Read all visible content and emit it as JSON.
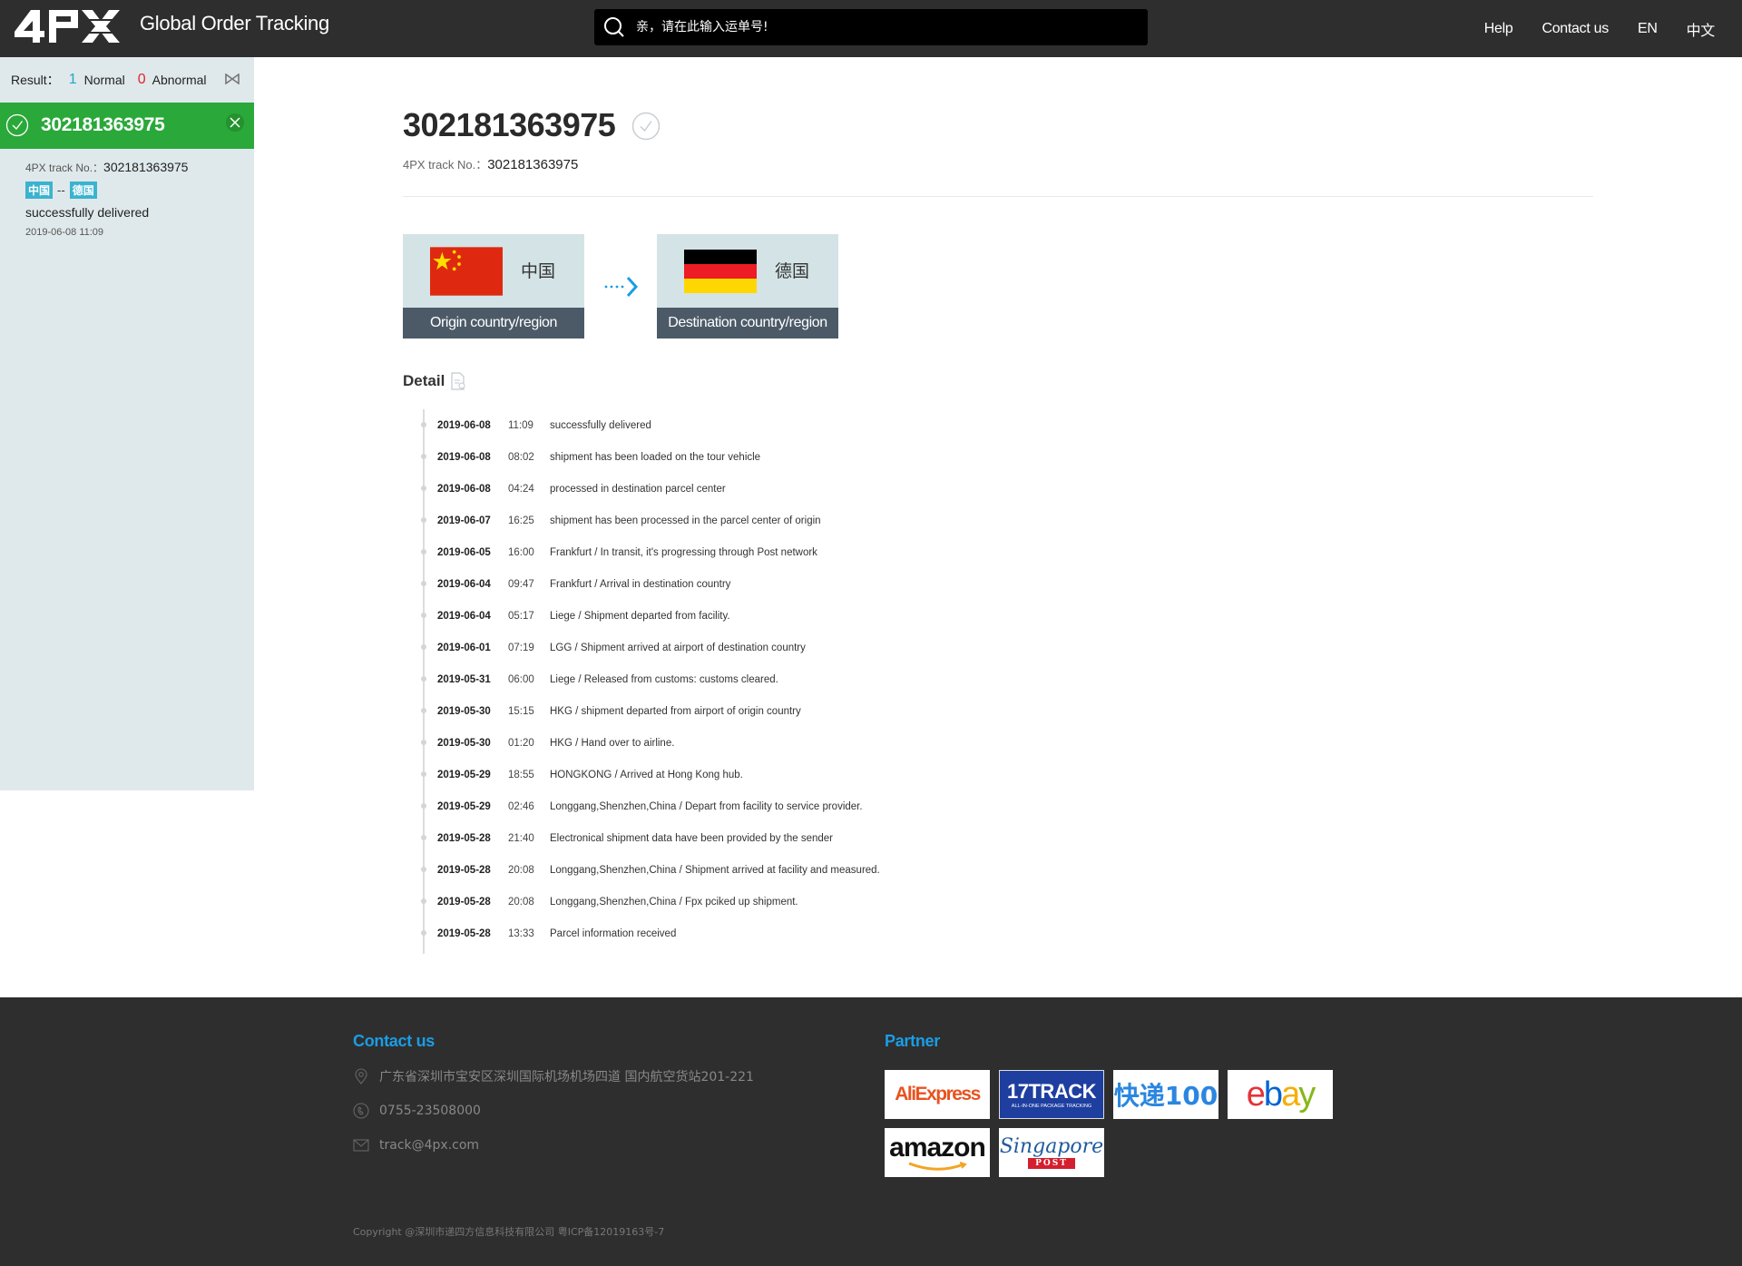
{
  "header": {
    "app_title": "Global Order Tracking",
    "search_placeholder": "亲，请在此输入运单号!",
    "nav": [
      "Help",
      "Contact us",
      "EN",
      "中文"
    ]
  },
  "sidebar": {
    "result_label": "Result：",
    "normal_count": "1",
    "normal_label": "Normal",
    "abnormal_count": "0",
    "abnormal_label": "Abnormal",
    "active_item": {
      "number": "302181363975",
      "track_label": "4PX track No.：",
      "track_no": "302181363975",
      "origin_tag": "中国",
      "tag_sep": "--",
      "dest_tag": "德国",
      "status": "successfully delivered",
      "time": "2019-06-08 11:09"
    }
  },
  "main": {
    "number": "302181363975",
    "track_label": "4PX track No.：",
    "track_no": "302181363975",
    "origin": {
      "name": "中国",
      "caption": "Origin country/region"
    },
    "destination": {
      "name": "德国",
      "caption": "Destination country/region"
    },
    "detail_title": "Detail",
    "events": [
      {
        "date": "2019-06-08",
        "time": "11:09",
        "desc": "successfully delivered"
      },
      {
        "date": "2019-06-08",
        "time": "08:02",
        "desc": "shipment has been loaded on the tour vehicle"
      },
      {
        "date": "2019-06-08",
        "time": "04:24",
        "desc": "processed in destination parcel center"
      },
      {
        "date": "2019-06-07",
        "time": "16:25",
        "desc": "shipment has been processed in the parcel center of origin"
      },
      {
        "date": "2019-06-05",
        "time": "16:00",
        "desc": "Frankfurt / In transit, it's progressing through Post network"
      },
      {
        "date": "2019-06-04",
        "time": "09:47",
        "desc": "Frankfurt / Arrival in destination country"
      },
      {
        "date": "2019-06-04",
        "time": "05:17",
        "desc": "Liege / Shipment departed from facility."
      },
      {
        "date": "2019-06-01",
        "time": "07:19",
        "desc": "LGG / Shipment arrived at airport of destination country"
      },
      {
        "date": "2019-05-31",
        "time": "06:00",
        "desc": "Liege / Released from customs: customs cleared."
      },
      {
        "date": "2019-05-30",
        "time": "15:15",
        "desc": "HKG / shipment departed from airport of origin country"
      },
      {
        "date": "2019-05-30",
        "time": "01:20",
        "desc": "HKG / Hand over to airline."
      },
      {
        "date": "2019-05-29",
        "time": "18:55",
        "desc": "HONGKONG / Arrived at Hong Kong hub."
      },
      {
        "date": "2019-05-29",
        "time": "02:46",
        "desc": "Longgang,Shenzhen,China / Depart from facility to service provider."
      },
      {
        "date": "2019-05-28",
        "time": "21:40",
        "desc": "Electronical shipment data have been provided by the sender"
      },
      {
        "date": "2019-05-28",
        "time": "20:08",
        "desc": "Longgang,Shenzhen,China / Shipment arrived at facility and measured."
      },
      {
        "date": "2019-05-28",
        "time": "20:08",
        "desc": "Longgang,Shenzhen,China / Fpx pciked up shipment."
      },
      {
        "date": "2019-05-28",
        "time": "13:33",
        "desc": "Parcel information received"
      }
    ]
  },
  "footer": {
    "contact_title": "Contact us",
    "address": "广东省深圳市宝安区深圳国际机场机场四道 国内航空货站201-221",
    "phone": "0755-23508000",
    "email": "track@4px.com",
    "partner_title": "Partner",
    "partners": [
      "AliExpress",
      "17TRACK",
      "快递100",
      "ebay",
      "amazon",
      "Singapore Post"
    ],
    "copyright": "Copyright @深圳市递四方信息科技有限公司 粤ICP备12019163号-7"
  },
  "colors": {
    "header_bg": "#2e2e2e",
    "sidebar_bg": "#dfe9eb",
    "active_green": "#2aa83a",
    "accent_blue": "#1a9de5",
    "normal_count": "#23a6c7",
    "abnormal_count": "#e4242b"
  }
}
